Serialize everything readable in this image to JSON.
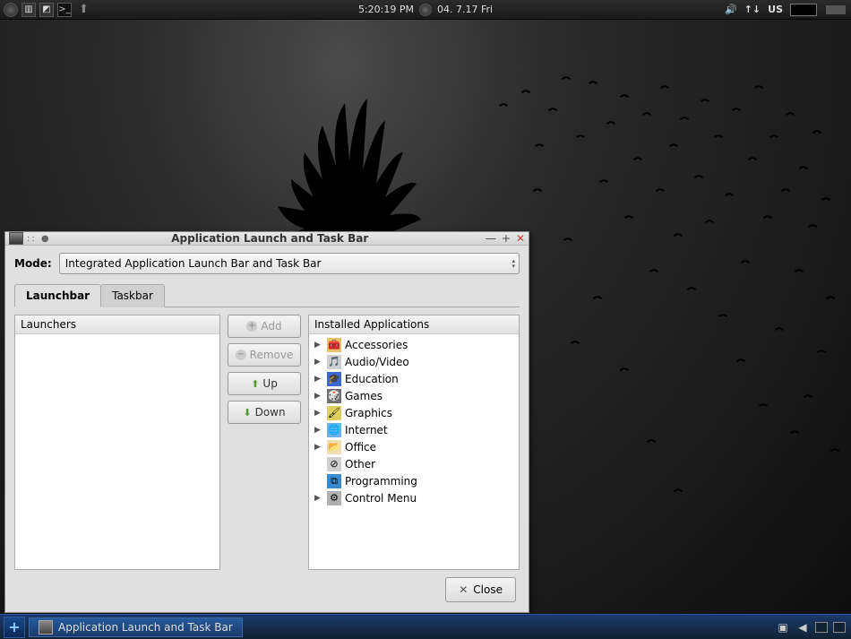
{
  "top_panel": {
    "time": "5:20:19 PM",
    "date": "04. 7.17 Fri",
    "keyboard_layout": "US"
  },
  "window": {
    "title": "Application Launch and Task Bar",
    "mode_label": "Mode:",
    "mode_value": "Integrated Application Launch Bar and Task Bar",
    "tabs": {
      "launchbar": "Launchbar",
      "taskbar": "Taskbar"
    },
    "launchers_header": "Launchers",
    "buttons": {
      "add": "Add",
      "remove": "Remove",
      "up": "Up",
      "down": "Down"
    },
    "apps_header": "Installed Applications",
    "categories": [
      {
        "label": "Accessories",
        "expandable": true,
        "icon": "🧰",
        "bg": "#e8c070"
      },
      {
        "label": "Audio/Video",
        "expandable": true,
        "icon": "🎵",
        "bg": "#d0d0d0"
      },
      {
        "label": "Education",
        "expandable": true,
        "icon": "🎓",
        "bg": "#3a6ad0"
      },
      {
        "label": "Games",
        "expandable": true,
        "icon": "🎲",
        "bg": "#707070"
      },
      {
        "label": "Graphics",
        "expandable": true,
        "icon": "🖌",
        "bg": "#e0d060"
      },
      {
        "label": "Internet",
        "expandable": true,
        "icon": "🌐",
        "bg": "#70b0e8"
      },
      {
        "label": "Office",
        "expandable": true,
        "icon": "📂",
        "bg": "#f0e0b0"
      },
      {
        "label": "Other",
        "expandable": false,
        "icon": "⊘",
        "bg": "#d0d0d0"
      },
      {
        "label": "Programming",
        "expandable": false,
        "icon": "⧉",
        "bg": "#3a8ad0"
      },
      {
        "label": "Control Menu",
        "expandable": true,
        "icon": "⚙",
        "bg": "#b0b0b0"
      }
    ],
    "close": "Close"
  },
  "bottom_panel": {
    "task_title": "Application Launch and Task Bar"
  }
}
